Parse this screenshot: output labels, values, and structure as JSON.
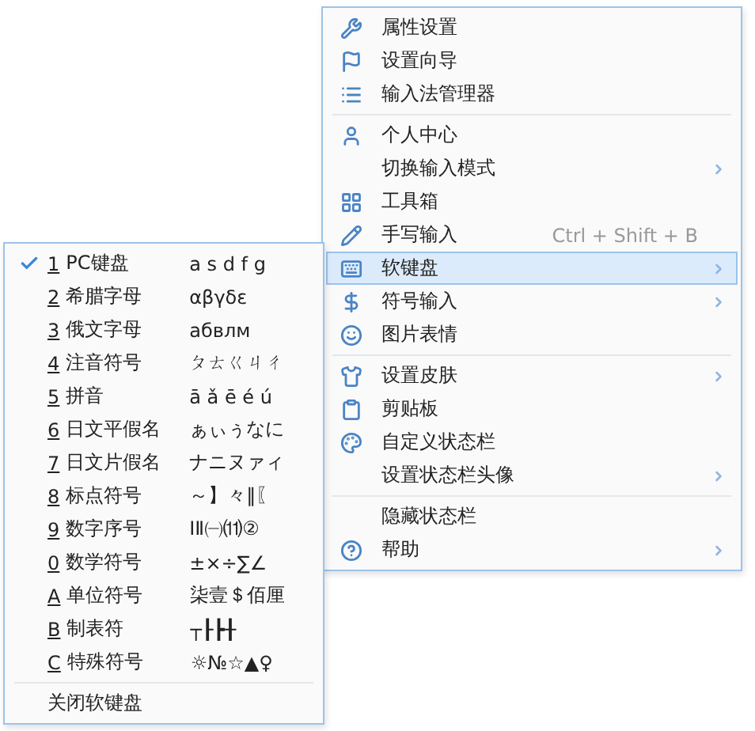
{
  "main_menu": {
    "groups": [
      [
        {
          "label": "属性设置",
          "submenu": false,
          "selected": false
        },
        {
          "label": "设置向导",
          "submenu": false,
          "selected": false
        },
        {
          "label": "输入法管理器",
          "submenu": false,
          "selected": false
        }
      ],
      [
        {
          "label": "个人中心",
          "submenu": false,
          "selected": false
        },
        {
          "label": "切换输入模式",
          "submenu": true,
          "selected": false
        },
        {
          "label": "工具箱",
          "submenu": false,
          "selected": false
        },
        {
          "label": "手写输入",
          "shortcut": "Ctrl + Shift + B",
          "submenu": false,
          "selected": false
        },
        {
          "label": "软键盘",
          "submenu": true,
          "selected": true
        },
        {
          "label": "符号输入",
          "submenu": true,
          "selected": false
        },
        {
          "label": "图片表情",
          "submenu": false,
          "selected": false
        }
      ],
      [
        {
          "label": "设置皮肤",
          "submenu": true,
          "selected": false
        },
        {
          "label": "剪贴板",
          "submenu": false,
          "selected": false
        },
        {
          "label": "自定义状态栏",
          "submenu": false,
          "selected": false
        },
        {
          "label": "设置状态栏头像",
          "submenu": true,
          "selected": false
        }
      ],
      [
        {
          "label": "隐藏状态栏",
          "submenu": false,
          "selected": false
        },
        {
          "label": "帮助",
          "submenu": true,
          "selected": false
        }
      ]
    ]
  },
  "soft_keyboard_menu": {
    "items": [
      {
        "key": "1",
        "label": "PC键盘",
        "sample": "a s d f g",
        "checked": true
      },
      {
        "key": "2",
        "label": "希腊字母",
        "sample": "αβγδε",
        "checked": false
      },
      {
        "key": "3",
        "label": "俄文字母",
        "sample": "абвлм",
        "checked": false
      },
      {
        "key": "4",
        "label": "注音符号",
        "sample": "ㄆㄊㄍㄐㄔ",
        "checked": false
      },
      {
        "key": "5",
        "label": "拼音",
        "sample": "ā ǎ ē é ú",
        "checked": false
      },
      {
        "key": "6",
        "label": "日文平假名",
        "sample": "ぁぃぅなに",
        "checked": false
      },
      {
        "key": "7",
        "label": "日文片假名",
        "sample": "ナニヌァィ",
        "checked": false
      },
      {
        "key": "8",
        "label": "标点符号",
        "sample": "～】々‖〖",
        "checked": false
      },
      {
        "key": "9",
        "label": "数字序号",
        "sample": "ⅠⅡ㈠⑾②",
        "checked": false
      },
      {
        "key": "0",
        "label": "数学符号",
        "sample": "±×÷∑∠",
        "checked": false
      },
      {
        "key": "A",
        "label": "单位符号",
        "sample": "柒壹＄佰厘",
        "checked": false
      },
      {
        "key": "B",
        "label": "制表符",
        "sample": "┬┠┣╂",
        "checked": false
      },
      {
        "key": "C",
        "label": "特殊符号",
        "sample": "☼№☆▲♀",
        "checked": false
      }
    ],
    "close_label": "关闭软键盘"
  }
}
